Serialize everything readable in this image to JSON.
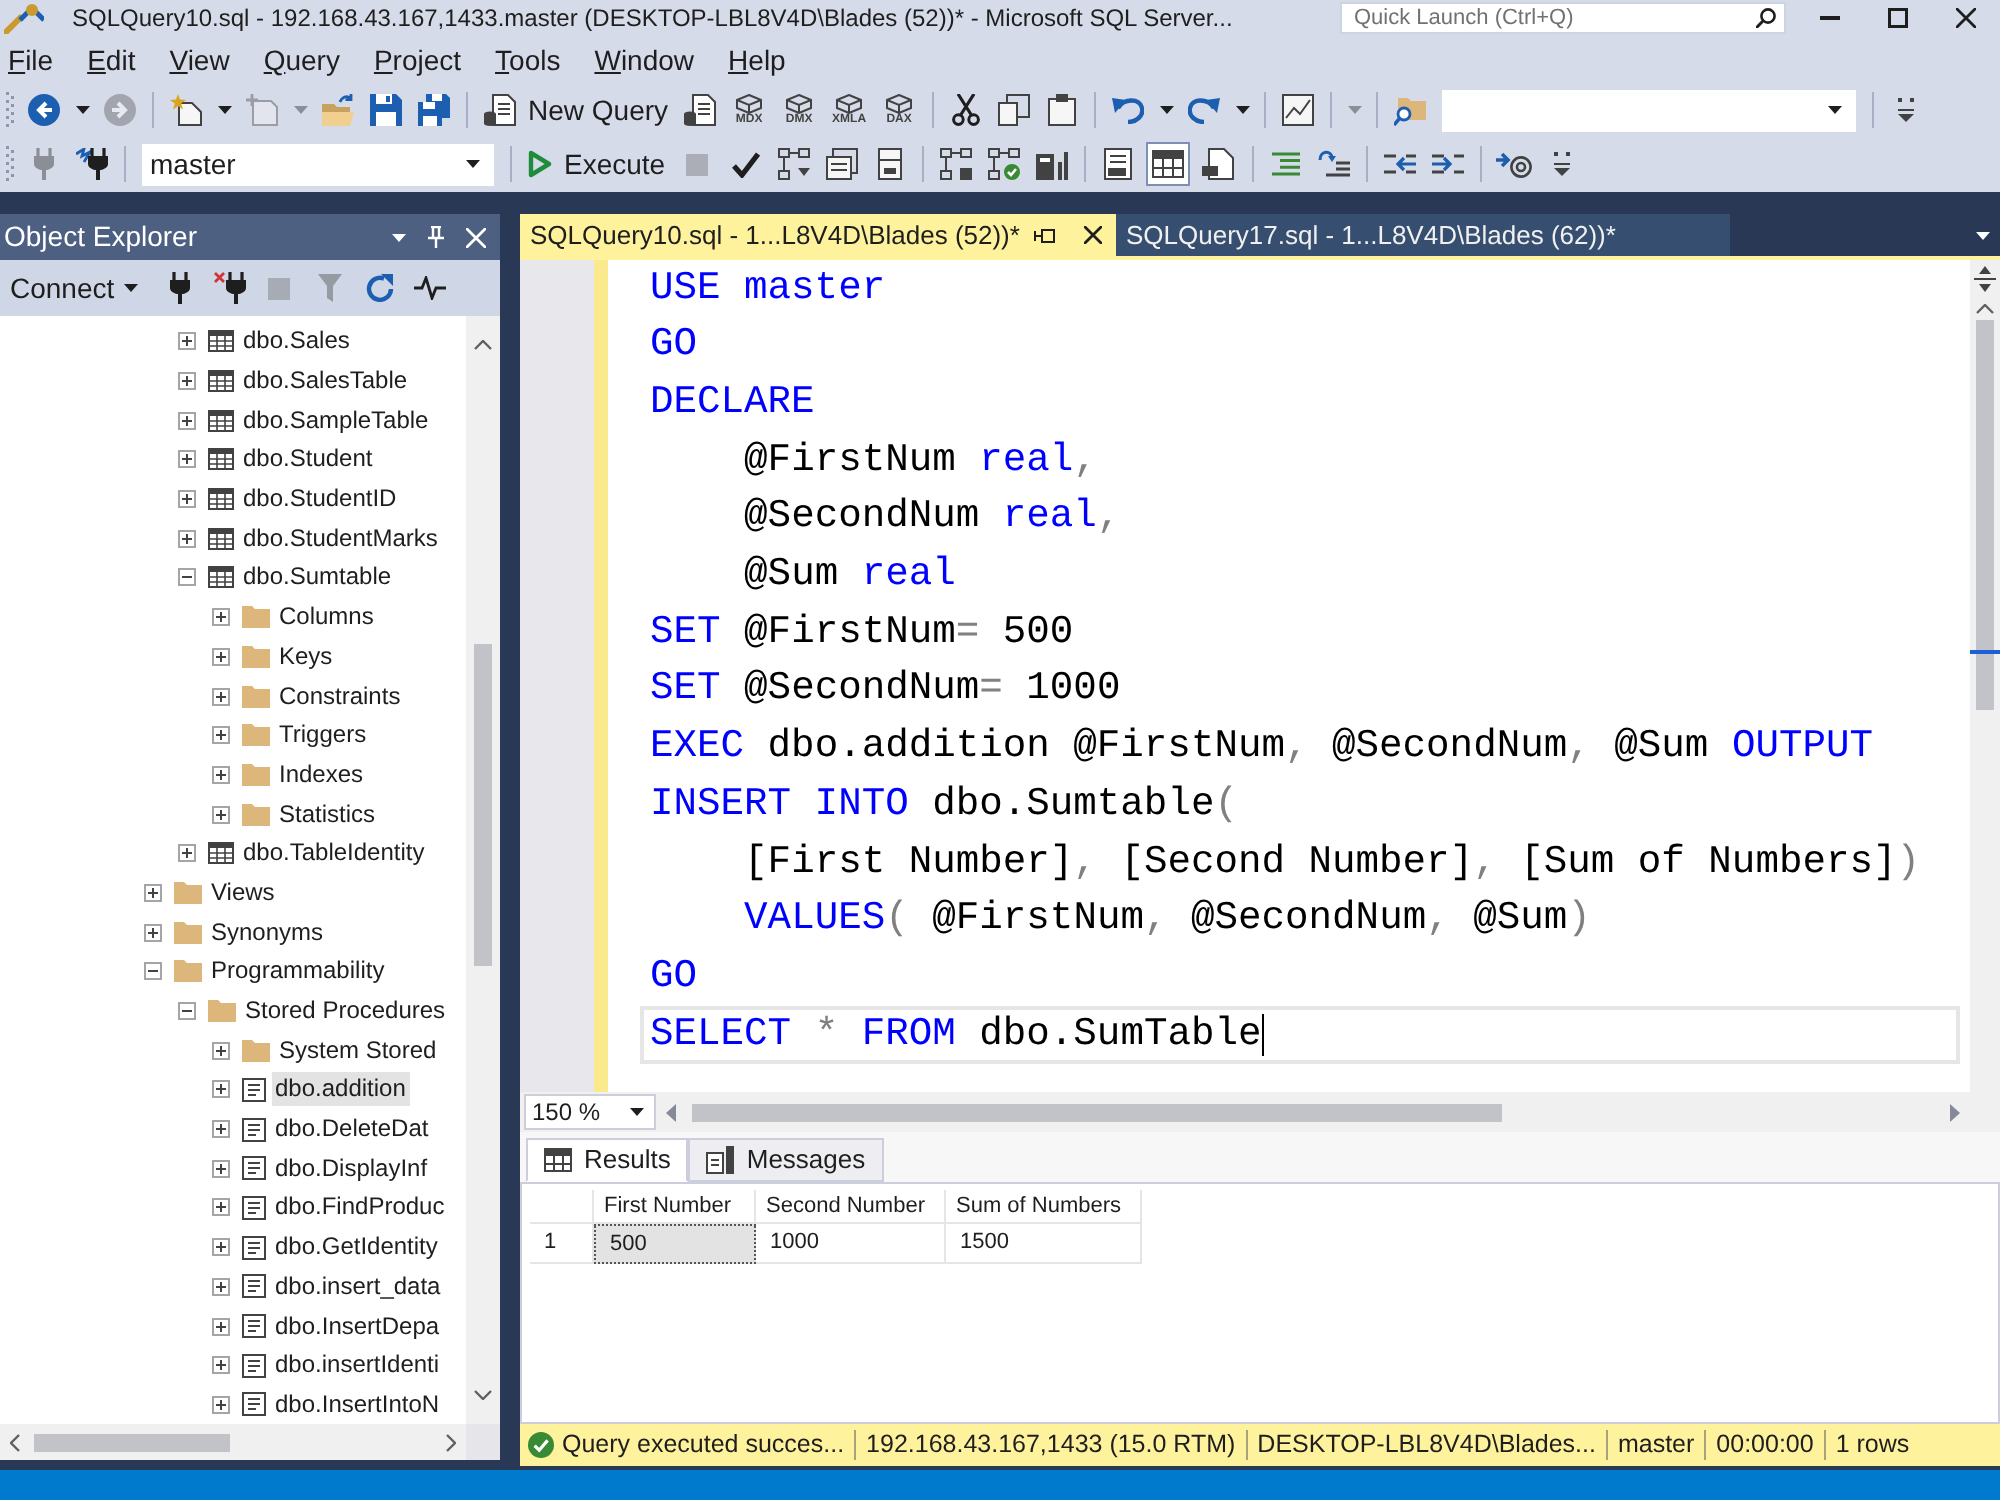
{
  "window": {
    "title": "SQLQuery10.sql - 192.168.43.167,1433.master (DESKTOP-LBL8V4D\\Blades (52))* - Microsoft SQL Server...",
    "quick_launch": {
      "placeholder": "Quick Launch (Ctrl+Q)"
    }
  },
  "menu": [
    "File",
    "Edit",
    "View",
    "Query",
    "Project",
    "Tools",
    "Window",
    "Help"
  ],
  "toolbar_standard": [
    {
      "kind": "grip"
    },
    {
      "kind": "back",
      "disabled": false
    },
    {
      "kind": "caret",
      "disabled": false
    },
    {
      "kind": "forward",
      "disabled": true
    },
    {
      "kind": "separator"
    },
    {
      "kind": "project",
      "disabled": false
    },
    {
      "kind": "caret",
      "disabled": false
    },
    {
      "kind": "item",
      "disabled": true
    },
    {
      "kind": "caret",
      "disabled": true
    },
    {
      "kind": "open",
      "disabled": false
    },
    {
      "kind": "save",
      "disabled": false
    },
    {
      "kind": "saveall",
      "disabled": false
    },
    {
      "kind": "separator"
    },
    {
      "kind": "query",
      "label": "New Query",
      "disabled": false
    },
    {
      "kind": "engine",
      "disabled": false
    },
    {
      "kind": "cube",
      "label": "MDX",
      "disabled": false
    },
    {
      "kind": "cube",
      "label": "DMX",
      "disabled": false
    },
    {
      "kind": "cube",
      "label": "XMLA",
      "disabled": false
    },
    {
      "kind": "cube",
      "label": "DAX",
      "disabled": false
    },
    {
      "kind": "separator"
    },
    {
      "kind": "cut",
      "disabled": false
    },
    {
      "kind": "copy",
      "disabled": false
    },
    {
      "kind": "paste",
      "disabled": false
    },
    {
      "kind": "separator"
    },
    {
      "kind": "undo",
      "disabled": false
    },
    {
      "kind": "caret",
      "disabled": false
    },
    {
      "kind": "redo",
      "disabled": false
    },
    {
      "kind": "caret",
      "disabled": false
    },
    {
      "kind": "separator"
    },
    {
      "kind": "monitor",
      "disabled": false
    },
    {
      "kind": "separator"
    },
    {
      "kind": "caret",
      "disabled": true
    },
    {
      "kind": "separator"
    },
    {
      "kind": "find",
      "disabled": false
    },
    {
      "kind": "combo",
      "disabled": false
    },
    {
      "kind": "separator"
    },
    {
      "kind": "overflow",
      "disabled": false
    }
  ],
  "toolbar_editor": [
    {
      "kind": "grip"
    },
    {
      "kind": "plug",
      "disabled": true
    },
    {
      "kind": "connection",
      "disabled": false
    },
    {
      "kind": "separator"
    },
    {
      "kind": "combo",
      "value": "master",
      "disabled": false
    },
    {
      "kind": "separator"
    },
    {
      "kind": "execute",
      "label": "Execute",
      "disabled": false
    },
    {
      "kind": "stop",
      "disabled": true
    },
    {
      "kind": "check",
      "disabled": false
    },
    {
      "kind": "plan",
      "disabled": false
    },
    {
      "kind": "options",
      "disabled": false
    },
    {
      "kind": "panel",
      "disabled": false
    },
    {
      "kind": "separator"
    },
    {
      "kind": "actualplan",
      "disabled": false
    },
    {
      "kind": "livestats",
      "disabled": false
    },
    {
      "kind": "clientstats",
      "disabled": false
    },
    {
      "kind": "separator"
    },
    {
      "kind": "textresults",
      "disabled": false,
      "selected": false
    },
    {
      "kind": "gridresults",
      "disabled": false,
      "selected": true
    },
    {
      "kind": "fileresults",
      "disabled": false,
      "selected": false
    },
    {
      "kind": "separator"
    },
    {
      "kind": "comment",
      "disabled": false
    },
    {
      "kind": "uncomment",
      "disabled": false
    },
    {
      "kind": "separator"
    },
    {
      "kind": "outdent",
      "disabled": false
    },
    {
      "kind": "indent",
      "disabled": false
    },
    {
      "kind": "separator"
    },
    {
      "kind": "template",
      "disabled": false
    },
    {
      "kind": "overflow",
      "disabled": false
    }
  ],
  "object_explorer": {
    "title": "Object Explorer",
    "toolbar": [
      {
        "kind": "connect",
        "label": "Connect",
        "disabled": false
      },
      {
        "kind": "plug",
        "disabled": false
      },
      {
        "kind": "disconnect",
        "disabled": false
      },
      {
        "kind": "stop",
        "disabled": true
      },
      {
        "kind": "filter",
        "disabled": true
      },
      {
        "kind": "refresh",
        "disabled": false
      },
      {
        "kind": "activity",
        "disabled": false
      }
    ],
    "tree": [
      {
        "children": [
          {
            "label": "dbo.Sales",
            "kind": "table",
            "expanded": false,
            "selected": false
          },
          {
            "label": "dbo.SalesTable",
            "kind": "table",
            "expanded": false,
            "selected": false
          },
          {
            "label": "dbo.SampleTable",
            "kind": "table",
            "expanded": false,
            "selected": false
          },
          {
            "label": "dbo.Student",
            "kind": "table",
            "expanded": false,
            "selected": false
          },
          {
            "label": "dbo.StudentID",
            "kind": "table",
            "expanded": false,
            "selected": false
          },
          {
            "label": "dbo.StudentMarks",
            "kind": "table",
            "expanded": false,
            "selected": false
          },
          {
            "label": "dbo.Sumtable",
            "kind": "table",
            "expanded": true,
            "selected": false,
            "children": [
              {
                "label": "Columns",
                "kind": "folder",
                "expanded": false,
                "selected": false
              },
              {
                "label": "Keys",
                "kind": "folder",
                "expanded": false,
                "selected": false
              },
              {
                "label": "Constraints",
                "kind": "folder",
                "expanded": false,
                "selected": false
              },
              {
                "label": "Triggers",
                "kind": "folder",
                "expanded": false,
                "selected": false
              },
              {
                "label": "Indexes",
                "kind": "folder",
                "expanded": false,
                "selected": false
              },
              {
                "label": "Statistics",
                "kind": "folder",
                "expanded": false,
                "selected": false
              }
            ]
          },
          {
            "label": "dbo.TableIdentity",
            "kind": "table",
            "expanded": false,
            "selected": false
          }
        ]
      },
      {
        "label": "Views",
        "kind": "folder",
        "expanded": false,
        "selected": false
      },
      {
        "label": "Synonyms",
        "kind": "folder",
        "expanded": false,
        "selected": false
      },
      {
        "label": "Programmability",
        "kind": "folder",
        "expanded": true,
        "selected": false,
        "children": [
          {
            "label": "Stored Procedures",
            "kind": "folder",
            "expanded": true,
            "selected": false,
            "children": [
              {
                "label": "System Stored",
                "kind": "folder",
                "expanded": false,
                "selected": false
              },
              {
                "label": "dbo.addition",
                "kind": "procedure",
                "expanded": false,
                "selected": true
              },
              {
                "label": "dbo.DeleteDat",
                "kind": "procedure",
                "expanded": false,
                "selected": false
              },
              {
                "label": "dbo.DisplayInf",
                "kind": "procedure",
                "expanded": false,
                "selected": false
              },
              {
                "label": "dbo.FindProduc",
                "kind": "procedure",
                "expanded": false,
                "selected": false
              },
              {
                "label": "dbo.GetIdentity",
                "kind": "procedure",
                "expanded": false,
                "selected": false
              },
              {
                "label": "dbo.insert_data",
                "kind": "procedure",
                "expanded": false,
                "selected": false
              },
              {
                "label": "dbo.InsertDepa",
                "kind": "procedure",
                "expanded": false,
                "selected": false
              },
              {
                "label": "dbo.insertIdenti",
                "kind": "procedure",
                "expanded": false,
                "selected": false
              },
              {
                "label": "dbo.InsertIntoN",
                "kind": "procedure",
                "expanded": false,
                "selected": false
              }
            ]
          }
        ]
      }
    ]
  },
  "editor": {
    "tabs": [
      {
        "label": "SQLQuery10.sql - 1...L8V4D\\Blades (52))*",
        "selected": true
      },
      {
        "label": "SQLQuery17.sql - 1...L8V4D\\Blades (62))*",
        "selected": false
      }
    ],
    "lines": [
      {
        "current": false,
        "tokens": [
          {
            "kind": "keyword",
            "text": "USE master"
          }
        ]
      },
      {
        "current": false,
        "tokens": [
          {
            "kind": "keyword",
            "text": "GO"
          }
        ]
      },
      {
        "current": false,
        "tokens": [
          {
            "kind": "keyword",
            "text": "DECLARE"
          }
        ]
      },
      {
        "current": false,
        "tokens": [
          {
            "kind": "plain",
            "text": "    @FirstNum "
          },
          {
            "kind": "keyword",
            "text": "real"
          },
          {
            "kind": "operator",
            "text": ","
          }
        ]
      },
      {
        "current": false,
        "tokens": [
          {
            "kind": "plain",
            "text": "    @SecondNum "
          },
          {
            "kind": "keyword",
            "text": "real"
          },
          {
            "kind": "operator",
            "text": ","
          }
        ]
      },
      {
        "current": false,
        "tokens": [
          {
            "kind": "plain",
            "text": "    @Sum "
          },
          {
            "kind": "keyword",
            "text": "real"
          }
        ]
      },
      {
        "current": false,
        "tokens": [
          {
            "kind": "keyword",
            "text": "SET "
          },
          {
            "kind": "plain",
            "text": "@FirstNum"
          },
          {
            "kind": "operator",
            "text": "="
          },
          {
            "kind": "plain",
            "text": " 500"
          }
        ]
      },
      {
        "current": false,
        "tokens": [
          {
            "kind": "keyword",
            "text": "SET "
          },
          {
            "kind": "plain",
            "text": "@SecondNum"
          },
          {
            "kind": "operator",
            "text": "="
          },
          {
            "kind": "plain",
            "text": " 1000"
          }
        ]
      },
      {
        "current": false,
        "tokens": [
          {
            "kind": "keyword",
            "text": "EXEC "
          },
          {
            "kind": "plain",
            "text": "dbo.addition @FirstNum"
          },
          {
            "kind": "operator",
            "text": ", "
          },
          {
            "kind": "plain",
            "text": "@SecondNum"
          },
          {
            "kind": "operator",
            "text": ", "
          },
          {
            "kind": "plain",
            "text": "@Sum "
          },
          {
            "kind": "keyword",
            "text": "OUTPUT"
          }
        ]
      },
      {
        "current": false,
        "tokens": [
          {
            "kind": "keyword",
            "text": "INSERT INTO "
          },
          {
            "kind": "plain",
            "text": "dbo.Sumtable"
          },
          {
            "kind": "operator",
            "text": "("
          }
        ]
      },
      {
        "current": false,
        "tokens": [
          {
            "kind": "plain",
            "text": "    [First Number]"
          },
          {
            "kind": "operator",
            "text": ", "
          },
          {
            "kind": "plain",
            "text": "[Second Number]"
          },
          {
            "kind": "operator",
            "text": ", "
          },
          {
            "kind": "plain",
            "text": "[Sum of Numbers]"
          },
          {
            "kind": "operator",
            "text": ")"
          }
        ]
      },
      {
        "current": false,
        "tokens": [
          {
            "kind": "keyword",
            "text": "    VALUES"
          },
          {
            "kind": "operator",
            "text": "( "
          },
          {
            "kind": "plain",
            "text": "@FirstNum"
          },
          {
            "kind": "operator",
            "text": ", "
          },
          {
            "kind": "plain",
            "text": "@SecondNum"
          },
          {
            "kind": "operator",
            "text": ", "
          },
          {
            "kind": "plain",
            "text": "@Sum"
          },
          {
            "kind": "operator",
            "text": ")"
          }
        ]
      },
      {
        "current": false,
        "tokens": [
          {
            "kind": "keyword",
            "text": "GO"
          }
        ]
      },
      {
        "current": true,
        "tokens": [
          {
            "kind": "keyword",
            "text": "SELECT "
          },
          {
            "kind": "operator",
            "text": "* "
          },
          {
            "kind": "keyword",
            "text": "FROM "
          },
          {
            "kind": "plain",
            "text": "dbo.SumTable"
          }
        ]
      }
    ],
    "zoom": "150 %"
  },
  "results": {
    "tabs": [
      {
        "label": "Results",
        "kind": "grid",
        "selected": true
      },
      {
        "label": "Messages",
        "kind": "messages",
        "selected": false
      }
    ],
    "columns": [
      "First Number",
      "Second Number",
      "Sum of Numbers"
    ],
    "rows": [
      {
        "number": "1",
        "cells": [
          {
            "text": "500",
            "selected": true
          },
          {
            "text": "1000",
            "selected": false
          },
          {
            "text": "1500",
            "selected": false
          }
        ]
      }
    ]
  },
  "status_bar": {
    "items": [
      {
        "kind": "success",
        "text": "Query executed succes..."
      },
      {
        "kind": "text",
        "text": "192.168.43.167,1433 (15.0 RTM)"
      },
      {
        "kind": "text",
        "text": "DESKTOP-LBL8V4D\\Blades..."
      },
      {
        "kind": "text",
        "text": "master"
      },
      {
        "kind": "text",
        "text": "00:00:00"
      },
      {
        "kind": "text",
        "text": "1 rows"
      }
    ]
  }
}
